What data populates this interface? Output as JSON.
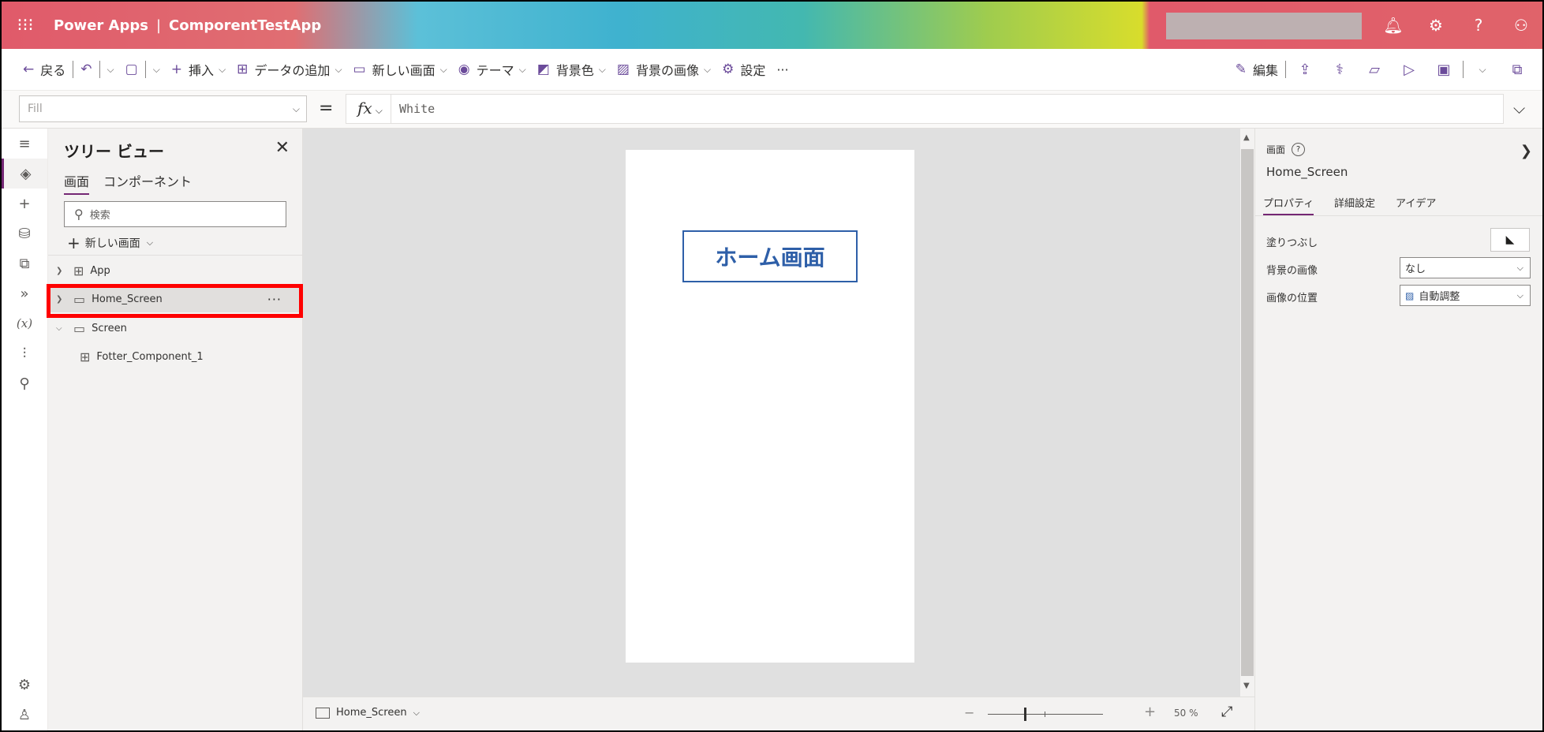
{
  "titlebar": {
    "product": "Power Apps",
    "separator": "|",
    "app_name": "ComporentTestApp",
    "icons": [
      "waffle-icon",
      "bell-icon",
      "gear-icon",
      "help-icon",
      "user-icon"
    ]
  },
  "commandbar": {
    "back": "戻る",
    "insert": "挿入",
    "add_data": "データの追加",
    "new_screen": "新しい画面",
    "theme": "テーマ",
    "background_color": "背景色",
    "background_image": "背景の画像",
    "settings": "設定",
    "more": "···",
    "edit": "編集"
  },
  "formulabar": {
    "property": "Fill",
    "equals": "=",
    "fx": "fx",
    "formula": "White"
  },
  "tree": {
    "title": "ツリー ビュー",
    "tabs": [
      "画面",
      "コンポーネント"
    ],
    "search_placeholder": "検索",
    "new_screen": "新しい画面",
    "nodes": [
      {
        "label": "App"
      },
      {
        "label": "Home_Screen",
        "more": "···"
      },
      {
        "label": "Screen"
      },
      {
        "label": "Fotter_Component_1"
      }
    ]
  },
  "canvas": {
    "label_text": "ホーム画面"
  },
  "footer": {
    "screen_name": "Home_Screen",
    "zoom_minus": "−",
    "zoom_plus": "+",
    "zoom_percent": "50 %",
    "zoom_level": 0.5
  },
  "properties": {
    "kind": "画面",
    "name": "Home_Screen",
    "tabs": [
      "プロパティ",
      "詳細設定",
      "アイデア"
    ],
    "fill_label": "塗りつぶし",
    "bg_image_label": "背景の画像",
    "bg_image_value": "なし",
    "image_position_label": "画像の位置",
    "image_position_value": "自動調整"
  },
  "colors": {
    "accent": "#742774",
    "label_border": "#2e5fa8",
    "highlight": "#ff0000"
  }
}
